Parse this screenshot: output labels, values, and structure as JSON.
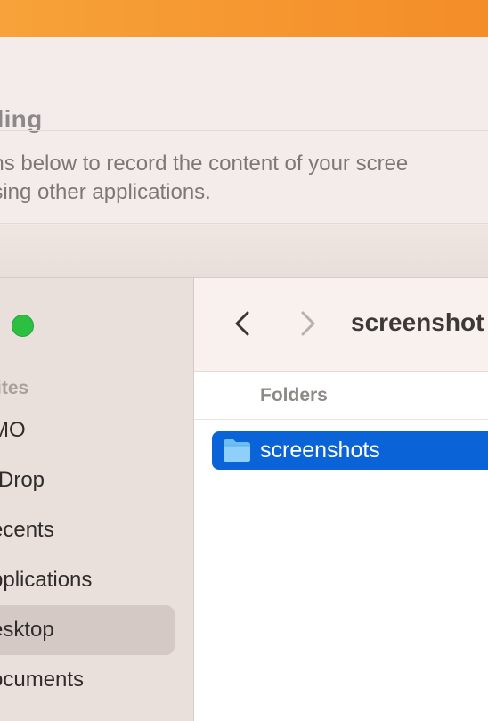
{
  "window": {
    "title_fragment": "rding",
    "description_line1": "ons below to record the content of your scree",
    "description_line2": "using other applications."
  },
  "sidebar": {
    "section_label": "ites",
    "items": [
      {
        "label": "MO"
      },
      {
        "label": "rDrop"
      },
      {
        "label": "ecents"
      },
      {
        "label": "pplications"
      },
      {
        "label": "esktop",
        "selected": true
      },
      {
        "label": "ocuments"
      }
    ]
  },
  "toolbar": {
    "current_folder": "screenshot"
  },
  "list": {
    "column_header": "Folders",
    "rows": [
      {
        "label": "screenshots",
        "selected": true
      }
    ]
  },
  "colors": {
    "accent": "#0b63d8",
    "top_bar": "#f48d27",
    "green_dot": "#2cc043"
  }
}
